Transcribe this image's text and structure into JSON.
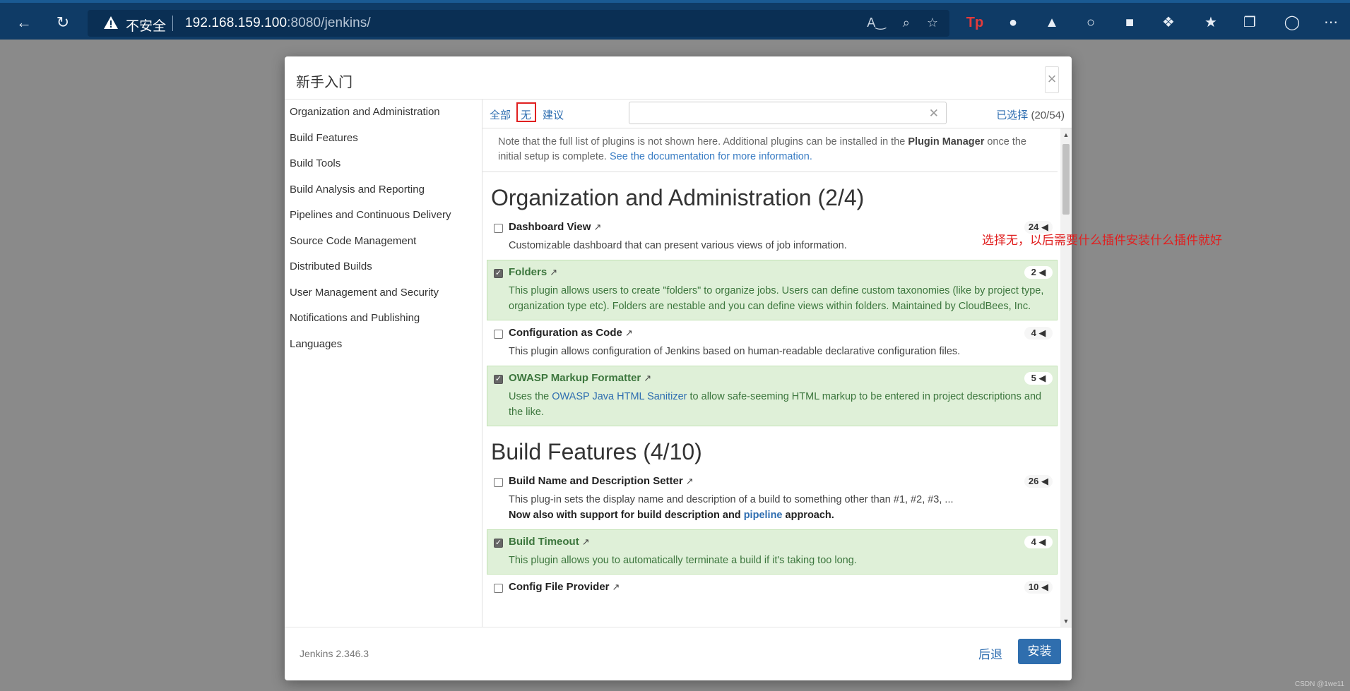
{
  "browser": {
    "insecure_label": "不安全",
    "url_host": "192.168.159.100",
    "url_rest": ":8080/jenkins/"
  },
  "modal": {
    "title": "新手入门",
    "close_label": "×"
  },
  "sidebar": {
    "items": [
      {
        "label": "Organization and Administration"
      },
      {
        "label": "Build Features"
      },
      {
        "label": "Build Tools"
      },
      {
        "label": "Build Analysis and Reporting"
      },
      {
        "label": "Pipelines and Continuous Delivery"
      },
      {
        "label": "Source Code Management"
      },
      {
        "label": "Distributed Builds"
      },
      {
        "label": "User Management and Security"
      },
      {
        "label": "Notifications and Publishing"
      },
      {
        "label": "Languages"
      }
    ]
  },
  "toolbar": {
    "all_label": "全部",
    "none_label": "无",
    "suggest_label": "建议",
    "search_value": "",
    "clear_label": "✕",
    "selected_label": "已选择",
    "selected_count": "(20/54)"
  },
  "note": {
    "text1": "Note that the full list of plugins is not shown here. Additional plugins can be installed in the ",
    "plugin_manager": "Plugin Manager",
    "text2": " once the initial setup is complete. ",
    "doc_link": "See the documentation for more information."
  },
  "sections": [
    {
      "title": "Organization and Administration (2/4)",
      "plugins": [
        {
          "name": "Dashboard View",
          "count": "24",
          "selected": false,
          "desc": "Customizable dashboard that can present various views of job information."
        },
        {
          "name": "Folders",
          "count": "2",
          "selected": true,
          "desc": "This plugin allows users to create \"folders\" to organize jobs. Users can define custom taxonomies (like by project type, organization type etc). Folders are nestable and you can define views within folders. Maintained by CloudBees, Inc."
        },
        {
          "name": "Configuration as Code",
          "count": "4",
          "selected": false,
          "desc": "This plugin allows configuration of Jenkins based on human-readable declarative configuration files."
        },
        {
          "name": "OWASP Markup Formatter",
          "count": "5",
          "selected": true,
          "desc_pre": "Uses the ",
          "desc_link": "OWASP Java HTML Sanitizer",
          "desc_post": " to allow safe-seeming HTML markup to be entered in project descriptions and the like."
        }
      ]
    },
    {
      "title": "Build Features (4/10)",
      "plugins": [
        {
          "name": "Build Name and Description Setter",
          "count": "26",
          "selected": false,
          "desc": "This plug-in sets the display name and description of a build to something other than #1, #2, #3, ...",
          "desc_bold_pre": "Now also with support for build description and ",
          "desc_bold_link": "pipeline",
          "desc_bold_post": " approach."
        },
        {
          "name": "Build Timeout",
          "count": "4",
          "selected": true,
          "desc": "This plugin allows you to automatically terminate a build if it's taking too long."
        },
        {
          "name": "Config File Provider",
          "count": "10",
          "selected": false,
          "desc": ""
        }
      ]
    }
  ],
  "annotation": "选择无，以后需要什么插件安装什么插件就好",
  "footer": {
    "version": "Jenkins 2.346.3",
    "later_label": "后退",
    "install_label": "安装"
  },
  "watermark": "CSDN @1we11"
}
